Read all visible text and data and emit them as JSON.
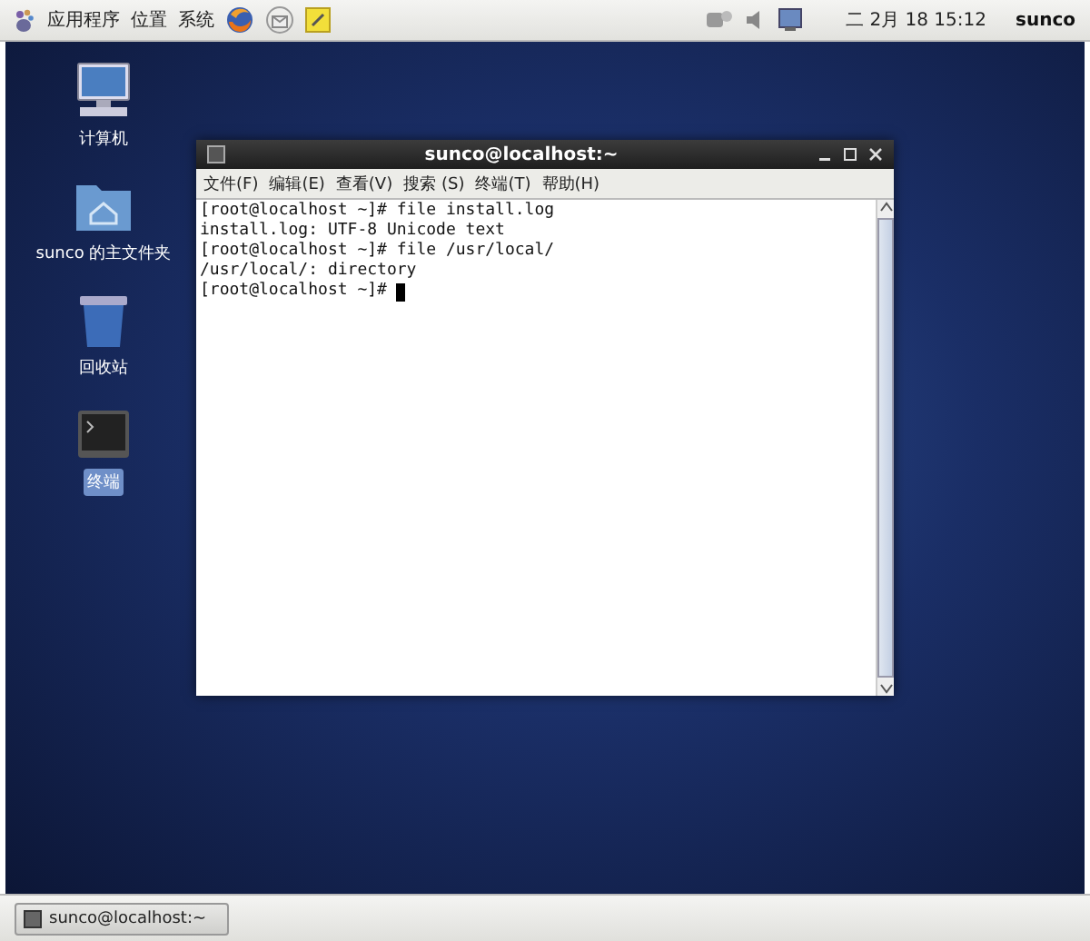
{
  "top_panel": {
    "menus": [
      {
        "label": "应用程序"
      },
      {
        "label": "位置"
      },
      {
        "label": "系统"
      }
    ],
    "clock": "二 2月 18 15:12",
    "user": "sunco"
  },
  "desktop_icons": [
    {
      "label": "计算机",
      "kind": "computer",
      "selected": false
    },
    {
      "label": "sunco 的主文件夹",
      "kind": "folder",
      "selected": false
    },
    {
      "label": "回收站",
      "kind": "trash",
      "selected": false
    },
    {
      "label": "终端",
      "kind": "terminal",
      "selected": true
    }
  ],
  "terminal": {
    "title": "sunco@localhost:~",
    "menu": [
      "文件(F)",
      "编辑(E)",
      "查看(V)",
      "搜索 (S)",
      "终端(T)",
      "帮助(H)"
    ],
    "lines": [
      "[root@localhost ~]# file install.log",
      "install.log: UTF-8 Unicode text",
      "[root@localhost ~]# file /usr/local/",
      "/usr/local/: directory",
      "[root@localhost ~]# "
    ]
  },
  "taskbar": {
    "items": [
      {
        "label": "sunco@localhost:~",
        "selected": false
      }
    ]
  }
}
